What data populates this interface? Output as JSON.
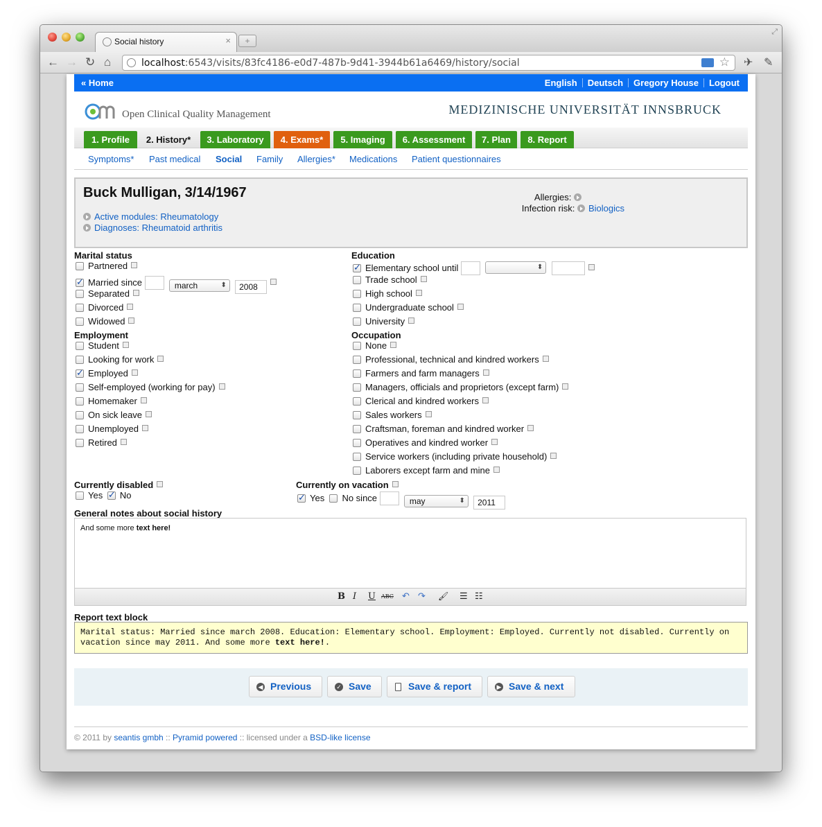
{
  "browser": {
    "tab_title": "Social history",
    "tab_close": "×",
    "newtab": "+",
    "url_host": "localhost",
    "url_rest": ":6543/visits/83fc4186-e0d7-487b-9d41-3944b61a6469/history/social",
    "back_icon": "←",
    "forward_icon": "→",
    "reload_icon": "↻",
    "home_icon": "⌂",
    "star_icon": "☆",
    "wrench_icon": "✎"
  },
  "topbar": {
    "home": "« Home",
    "lang_en": "English",
    "lang_de": "Deutsch",
    "user": "Gregory House",
    "logout": "Logout"
  },
  "branding": {
    "app_name": "Open Clinical Quality Management",
    "university": "MEDIZINISCHE UNIVERSITÄT INNSBRUCK"
  },
  "main_tabs": [
    {
      "label": "1. Profile",
      "style": "green"
    },
    {
      "label": "2. History*",
      "style": "active"
    },
    {
      "label": "3. Laboratory",
      "style": "green"
    },
    {
      "label": "4. Exams*",
      "style": "orange"
    },
    {
      "label": "5. Imaging",
      "style": "green"
    },
    {
      "label": "6. Assessment",
      "style": "green"
    },
    {
      "label": "7. Plan",
      "style": "green"
    },
    {
      "label": "8. Report",
      "style": "green"
    }
  ],
  "sub_tabs": [
    "Symptoms*",
    "Past medical",
    "Social",
    "Family",
    "Allergies*",
    "Medications",
    "Patient questionnaires"
  ],
  "patient": {
    "name": "Buck Mulligan, 3/14/1967",
    "modules": "Active modules: Rheumatology",
    "diagnoses": "Diagnoses: Rheumatoid arthritis",
    "allergies_label": "Allergies:",
    "infection_label": "Infection risk:",
    "infection_value": "Biologics"
  },
  "marital": {
    "title": "Marital status",
    "options": [
      {
        "label": "Partnered",
        "checked": false
      },
      {
        "label": "Married since",
        "checked": true
      },
      {
        "label": "Separated",
        "checked": false
      },
      {
        "label": "Divorced",
        "checked": false
      },
      {
        "label": "Widowed",
        "checked": false
      }
    ],
    "married_day": "",
    "married_month": "march",
    "married_year": "2008"
  },
  "education": {
    "title": "Education",
    "options": [
      {
        "label": "Elementary school until",
        "checked": true
      },
      {
        "label": "Trade school",
        "checked": false
      },
      {
        "label": "High school",
        "checked": false
      },
      {
        "label": "Undergraduate school",
        "checked": false
      },
      {
        "label": "University",
        "checked": false
      }
    ]
  },
  "employment": {
    "title": "Employment",
    "options": [
      {
        "label": "Student",
        "checked": false
      },
      {
        "label": "Looking for work",
        "checked": false
      },
      {
        "label": "Employed",
        "checked": true
      },
      {
        "label": "Self-employed (working for pay)",
        "checked": false
      },
      {
        "label": "Homemaker",
        "checked": false
      },
      {
        "label": "On sick leave",
        "checked": false
      },
      {
        "label": "Unemployed",
        "checked": false
      },
      {
        "label": "Retired",
        "checked": false
      }
    ]
  },
  "occupation": {
    "title": "Occupation",
    "options": [
      {
        "label": "None",
        "checked": false
      },
      {
        "label": "Professional, technical and kindred workers",
        "checked": false
      },
      {
        "label": "Farmers and farm managers",
        "checked": false
      },
      {
        "label": "Managers, officials and proprietors (except farm)",
        "checked": false
      },
      {
        "label": "Clerical and kindred workers",
        "checked": false
      },
      {
        "label": "Sales workers",
        "checked": false
      },
      {
        "label": "Craftsman, foreman and kindred worker",
        "checked": false
      },
      {
        "label": "Operatives and kindred worker",
        "checked": false
      },
      {
        "label": "Service workers (including private household)",
        "checked": false
      },
      {
        "label": "Laborers except farm and mine",
        "checked": false
      }
    ]
  },
  "disabled": {
    "title": "Currently disabled",
    "yes": "Yes",
    "no": "No",
    "yes_checked": false,
    "no_checked": true
  },
  "vacation": {
    "title": "Currently on vacation",
    "yes": "Yes",
    "no_since": "No since",
    "yes_checked": true,
    "no_checked": false,
    "month": "may",
    "year": "2011"
  },
  "notes": {
    "title": "General notes about social history",
    "text_plain": "And some more ",
    "text_bold": "text here!",
    "toolbar": [
      "B",
      "I",
      "U",
      "ABC",
      "↶",
      "↷",
      "🖌",
      "☰",
      "☷"
    ]
  },
  "report": {
    "title": "Report text block",
    "text_plain": "Marital status: Married since march 2008. Education: Elementary school. Employment: Employed. Currently not disabled. Currently on vacation since may 2011. And some more ",
    "text_bold": "text here!",
    "text_end": "."
  },
  "actions": {
    "previous": "Previous",
    "save": "Save",
    "save_report": "Save & report",
    "save_next": "Save & next"
  },
  "footer": {
    "prefix": "© 2011 by ",
    "company": "seantis gmbh",
    "sep1": " :: ",
    "pyramid": "Pyramid powered",
    "licensed": " :: licensed under a ",
    "license": "BSD-like license"
  },
  "colors": {
    "topbar": "#0a6ff2",
    "tab_green": "#3a9a1e",
    "tab_orange": "#e0600e",
    "link": "#1261c4",
    "report_bg": "#ffffcf"
  }
}
